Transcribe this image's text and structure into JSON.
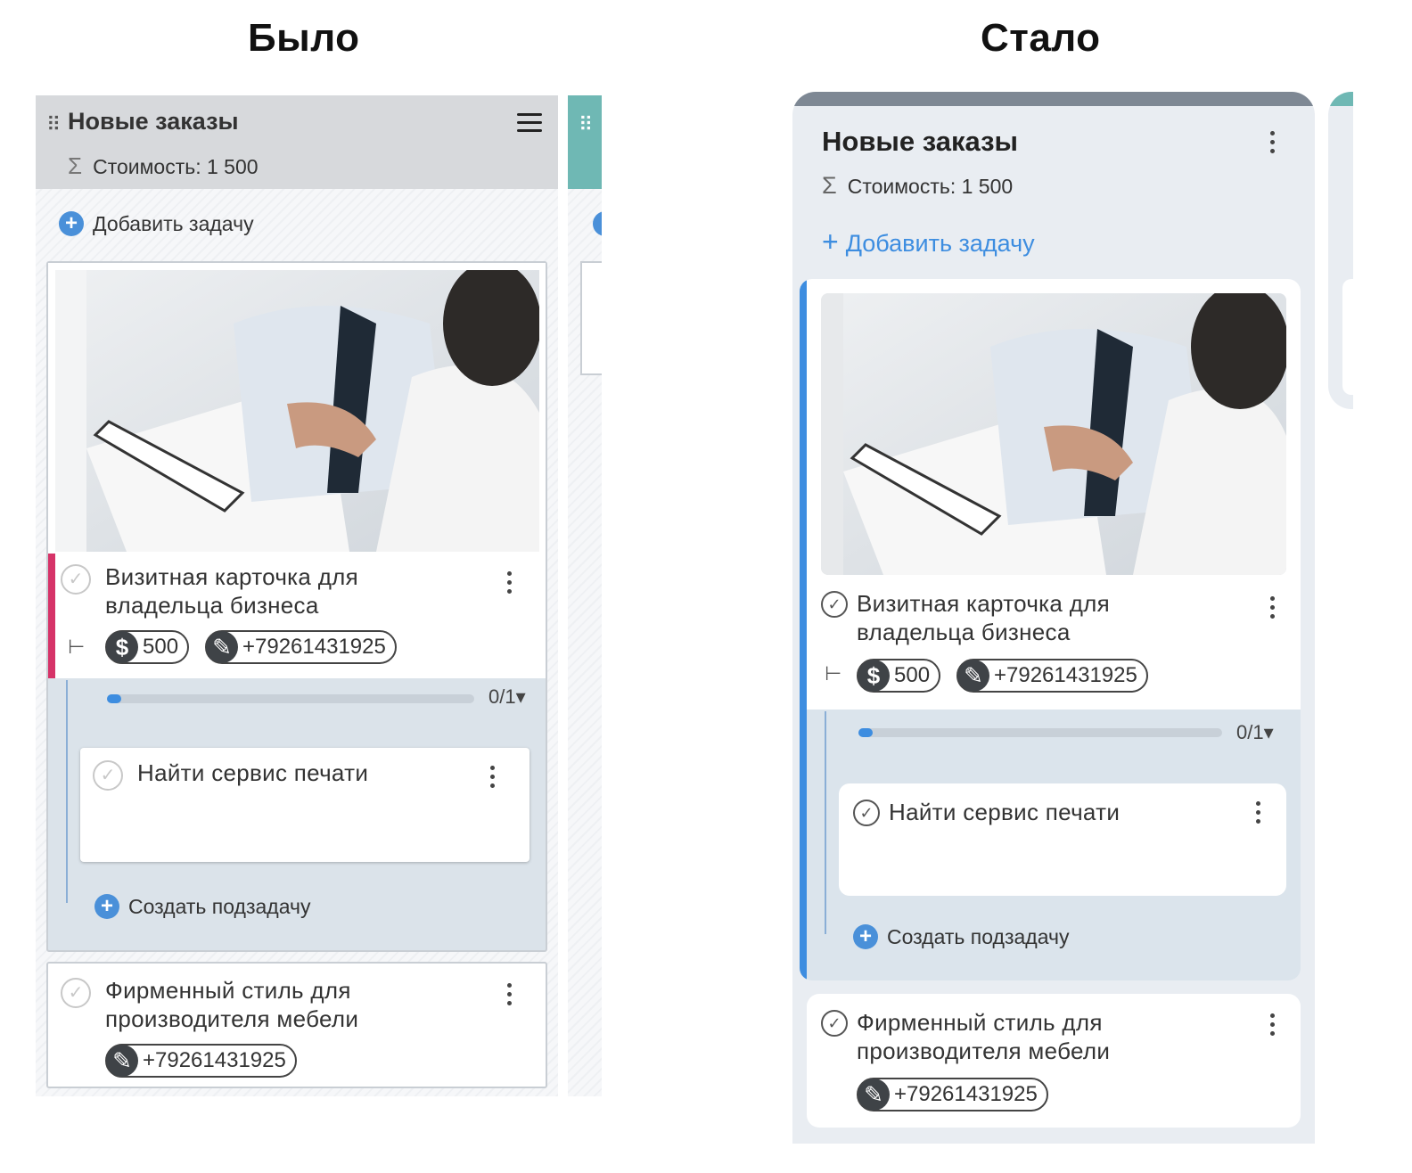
{
  "headings": {
    "before": "Было",
    "after": "Стало"
  },
  "column": {
    "title": "Новые заказы",
    "sum_label": "Стоимость: 1 500",
    "sum_icon": "sigma-icon",
    "add_task_label": "Добавить задачу"
  },
  "task1": {
    "title_line1": "Визитная карточка для",
    "title_line2": "владельца бизнеса",
    "price": "500",
    "phone": "+79261431925",
    "progress_count": "0/1",
    "progress_fraction": 0.0,
    "subtask": {
      "title": "Найти сервис печати"
    },
    "create_subtask_label": "Создать подзадачу"
  },
  "task2": {
    "title_line1": "Фирменный стиль для",
    "title_line2": "производителя мебели",
    "phone": "+79261431925"
  },
  "colors": {
    "old_header": "#d7d9dc",
    "old_accent_bar": "#d63368",
    "new_accent_bar": "#3d8de0",
    "new_top_bar": "#7e8894",
    "next_column": "#6fb8b4",
    "link_blue": "#3d8de0"
  }
}
